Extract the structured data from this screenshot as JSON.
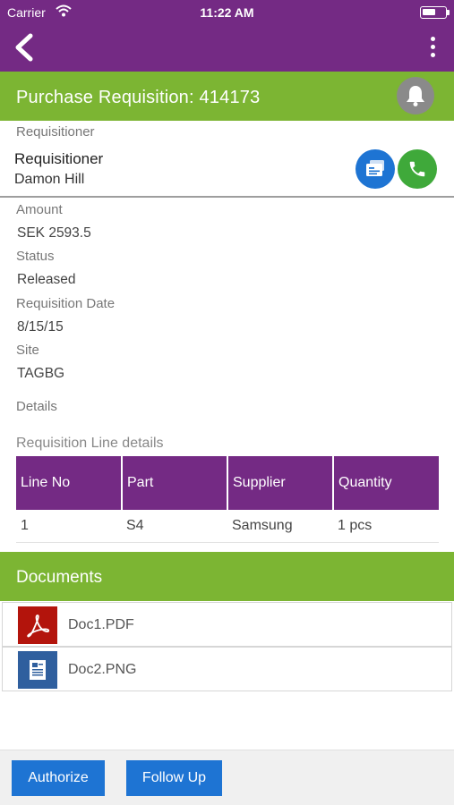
{
  "status_bar": {
    "carrier": "Carrier",
    "time": "11:22 AM"
  },
  "header": {
    "title": "Purchase Requisition: 414173"
  },
  "requisitioner": {
    "section_label": "Requisitioner",
    "heading": "Requisitioner",
    "name": "Damon Hill"
  },
  "fields": [
    {
      "label": "Amount",
      "value": "SEK 2593.5"
    },
    {
      "label": "Status",
      "value": "Released"
    },
    {
      "label": "Requisition Date",
      "value": "8/15/15"
    },
    {
      "label": "Site",
      "value": "TAGBG"
    }
  ],
  "details_label": "Details",
  "line_details": {
    "label": "Requisition Line details",
    "columns": [
      "Line No",
      "Part",
      "Supplier",
      "Quantity"
    ],
    "rows": [
      [
        "1",
        "S4",
        "Samsung",
        "1 pcs"
      ]
    ]
  },
  "documents": {
    "title": "Documents",
    "items": [
      {
        "name": "Doc1.PDF",
        "icon": "pdf-icon"
      },
      {
        "name": "Doc2.PNG",
        "icon": "image-file-icon"
      }
    ]
  },
  "actions": {
    "authorize": "Authorize",
    "follow_up": "Follow Up"
  },
  "colors": {
    "primary": "#742a84",
    "accent_green": "#7cb533",
    "button_blue": "#1e74d3",
    "call_green": "#3fa93a"
  }
}
